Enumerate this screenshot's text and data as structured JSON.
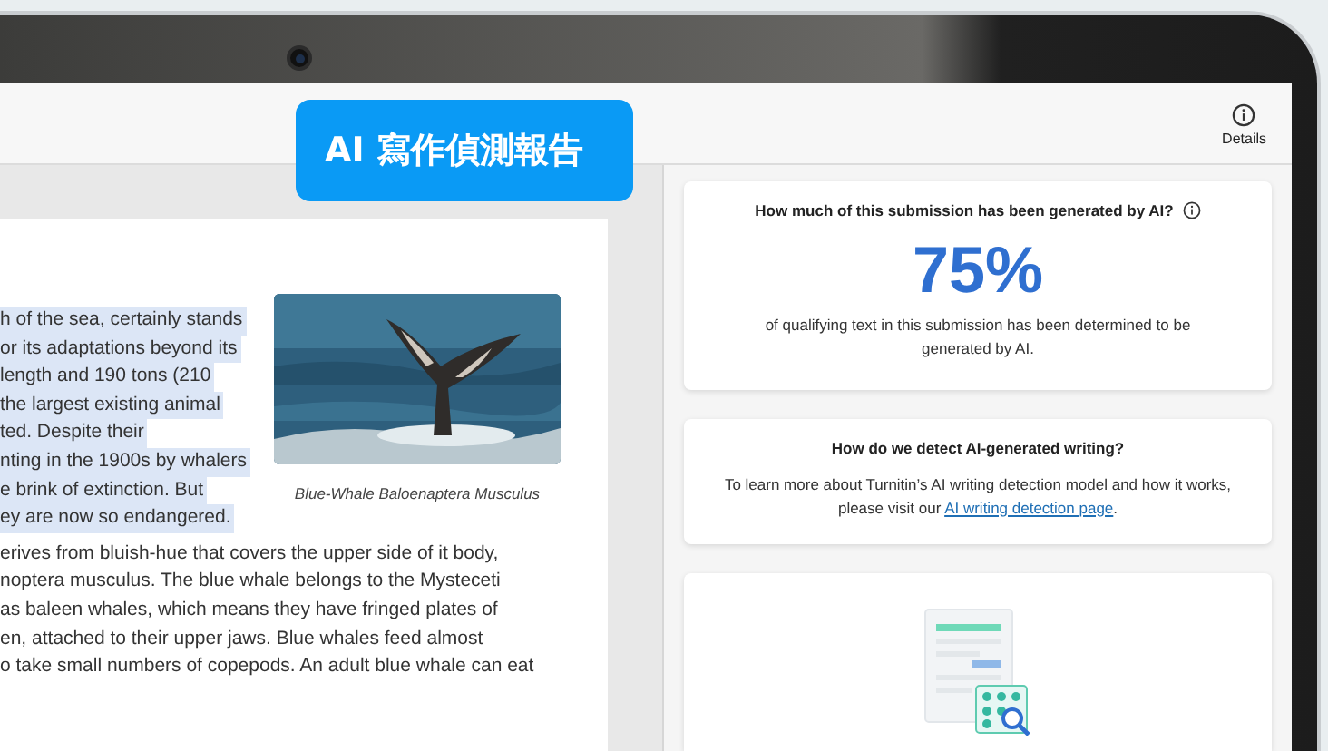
{
  "badge": "AI 寫作偵測報告",
  "header": {
    "details_label": "Details"
  },
  "document": {
    "wrapped_lines": [
      {
        "text": "h of the sea, certainly stands",
        "highlighted": true
      },
      {
        "text": "or its adaptations beyond its",
        "highlighted": true
      },
      {
        "text": "length and 190 tons (210",
        "highlighted": true
      },
      {
        "text": "the largest existing animal",
        "highlighted": true
      },
      {
        "text": "ted. Despite their",
        "highlighted": true
      },
      {
        "text": "nting in the 1900s by whalers",
        "highlighted": true
      },
      {
        "text": "e brink of extinction. But",
        "highlighted": true
      },
      {
        "text": "ey are now so endangered.",
        "highlighted": true
      }
    ],
    "figure": {
      "caption": "Blue-Whale Baloenaptera Musculus"
    },
    "lines": [
      {
        "text": "erives from bluish-hue that covers the upper side of it body,",
        "highlighted": false
      },
      {
        "text": "noptera musculus. The blue whale belongs to the Mysteceti",
        "highlighted": false
      },
      {
        "text": "as baleen whales, which means they have fringed plates of",
        "highlighted": false
      },
      {
        "text": "en, attached to their upper jaws. Blue whales feed almost",
        "highlighted": false
      },
      {
        "text": "o take small numbers of copepods. An adult blue whale can eat",
        "highlighted": false
      }
    ]
  },
  "ai_score_card": {
    "question": "How much of this submission has been generated by AI?",
    "score": "75%",
    "description": "of qualifying text in this submission has been determined to be generated by AI."
  },
  "detection_card": {
    "title": "How do we detect AI-generated writing?",
    "text_before": "To learn more about Turnitin’s AI writing detection model and how it works, please visit our ",
    "link": "AI writing detection page",
    "text_after": "."
  }
}
